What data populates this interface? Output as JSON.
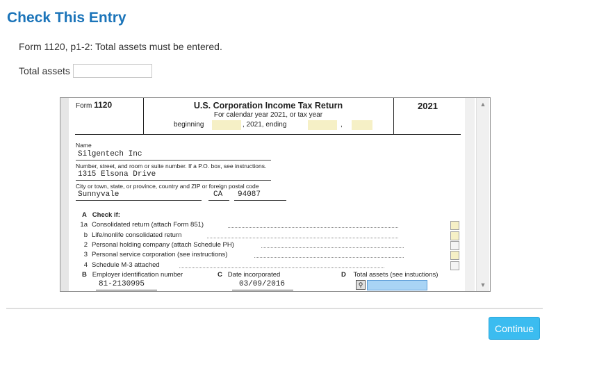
{
  "page": {
    "title": "Check This Entry",
    "message": "Form 1120, p1-2: Total assets must be entered.",
    "field_label": "Total assets",
    "field_value": "",
    "continue_label": "Continue"
  },
  "form": {
    "form_label": "Form",
    "form_number": "1120",
    "title": "U.S. Corporation Income Tax Return",
    "subtitle": "For calendar year 2021, or tax year",
    "year": "2021",
    "beginning_label": "beginning",
    "ending_label": ", 2021, ending",
    "comma": ",",
    "name_label": "Name",
    "name_value": "Silgentech Inc",
    "street_label": "Number, street, and room or suite number.  If a P.O. box, see instructions.",
    "street_value": "1315 Elsona Drive",
    "city_label": "City or town, state, or province, country and ZIP or foreign postal code",
    "city_value": "Sunnyvale",
    "state_value": "CA",
    "zip_value": "94087",
    "check_if_letter": "A",
    "check_if_label": "Check if:",
    "check_items": [
      {
        "num": "1a",
        "text": "Consolidated return (attach Form 851)"
      },
      {
        "num": "b",
        "text": "Life/nonlife consolidated return"
      },
      {
        "num": "2",
        "text": "Personal holding company (attach Schedule PH)"
      },
      {
        "num": "3",
        "text": "Personal service corporation (see instructions)"
      },
      {
        "num": "4",
        "text": "Schedule M-3 attached"
      }
    ],
    "b_letter": "B",
    "ein_label": "Employer identification number",
    "ein_value": "81-2130995",
    "c_letter": "C",
    "date_label": "Date incorporated",
    "date_value": "03/09/2016",
    "d_letter": "D",
    "total_assets_label": "Total assets (see instuctions)"
  },
  "icons": {
    "magnifier": "magnifier-icon",
    "scroll_up": "chevron-up-icon",
    "scroll_down": "chevron-down-icon"
  },
  "colors": {
    "title": "#1b74b9",
    "continue_bg": "#3bbcf0",
    "input_highlight": "#f6f0c6",
    "focus_field": "#a9d4f5"
  }
}
